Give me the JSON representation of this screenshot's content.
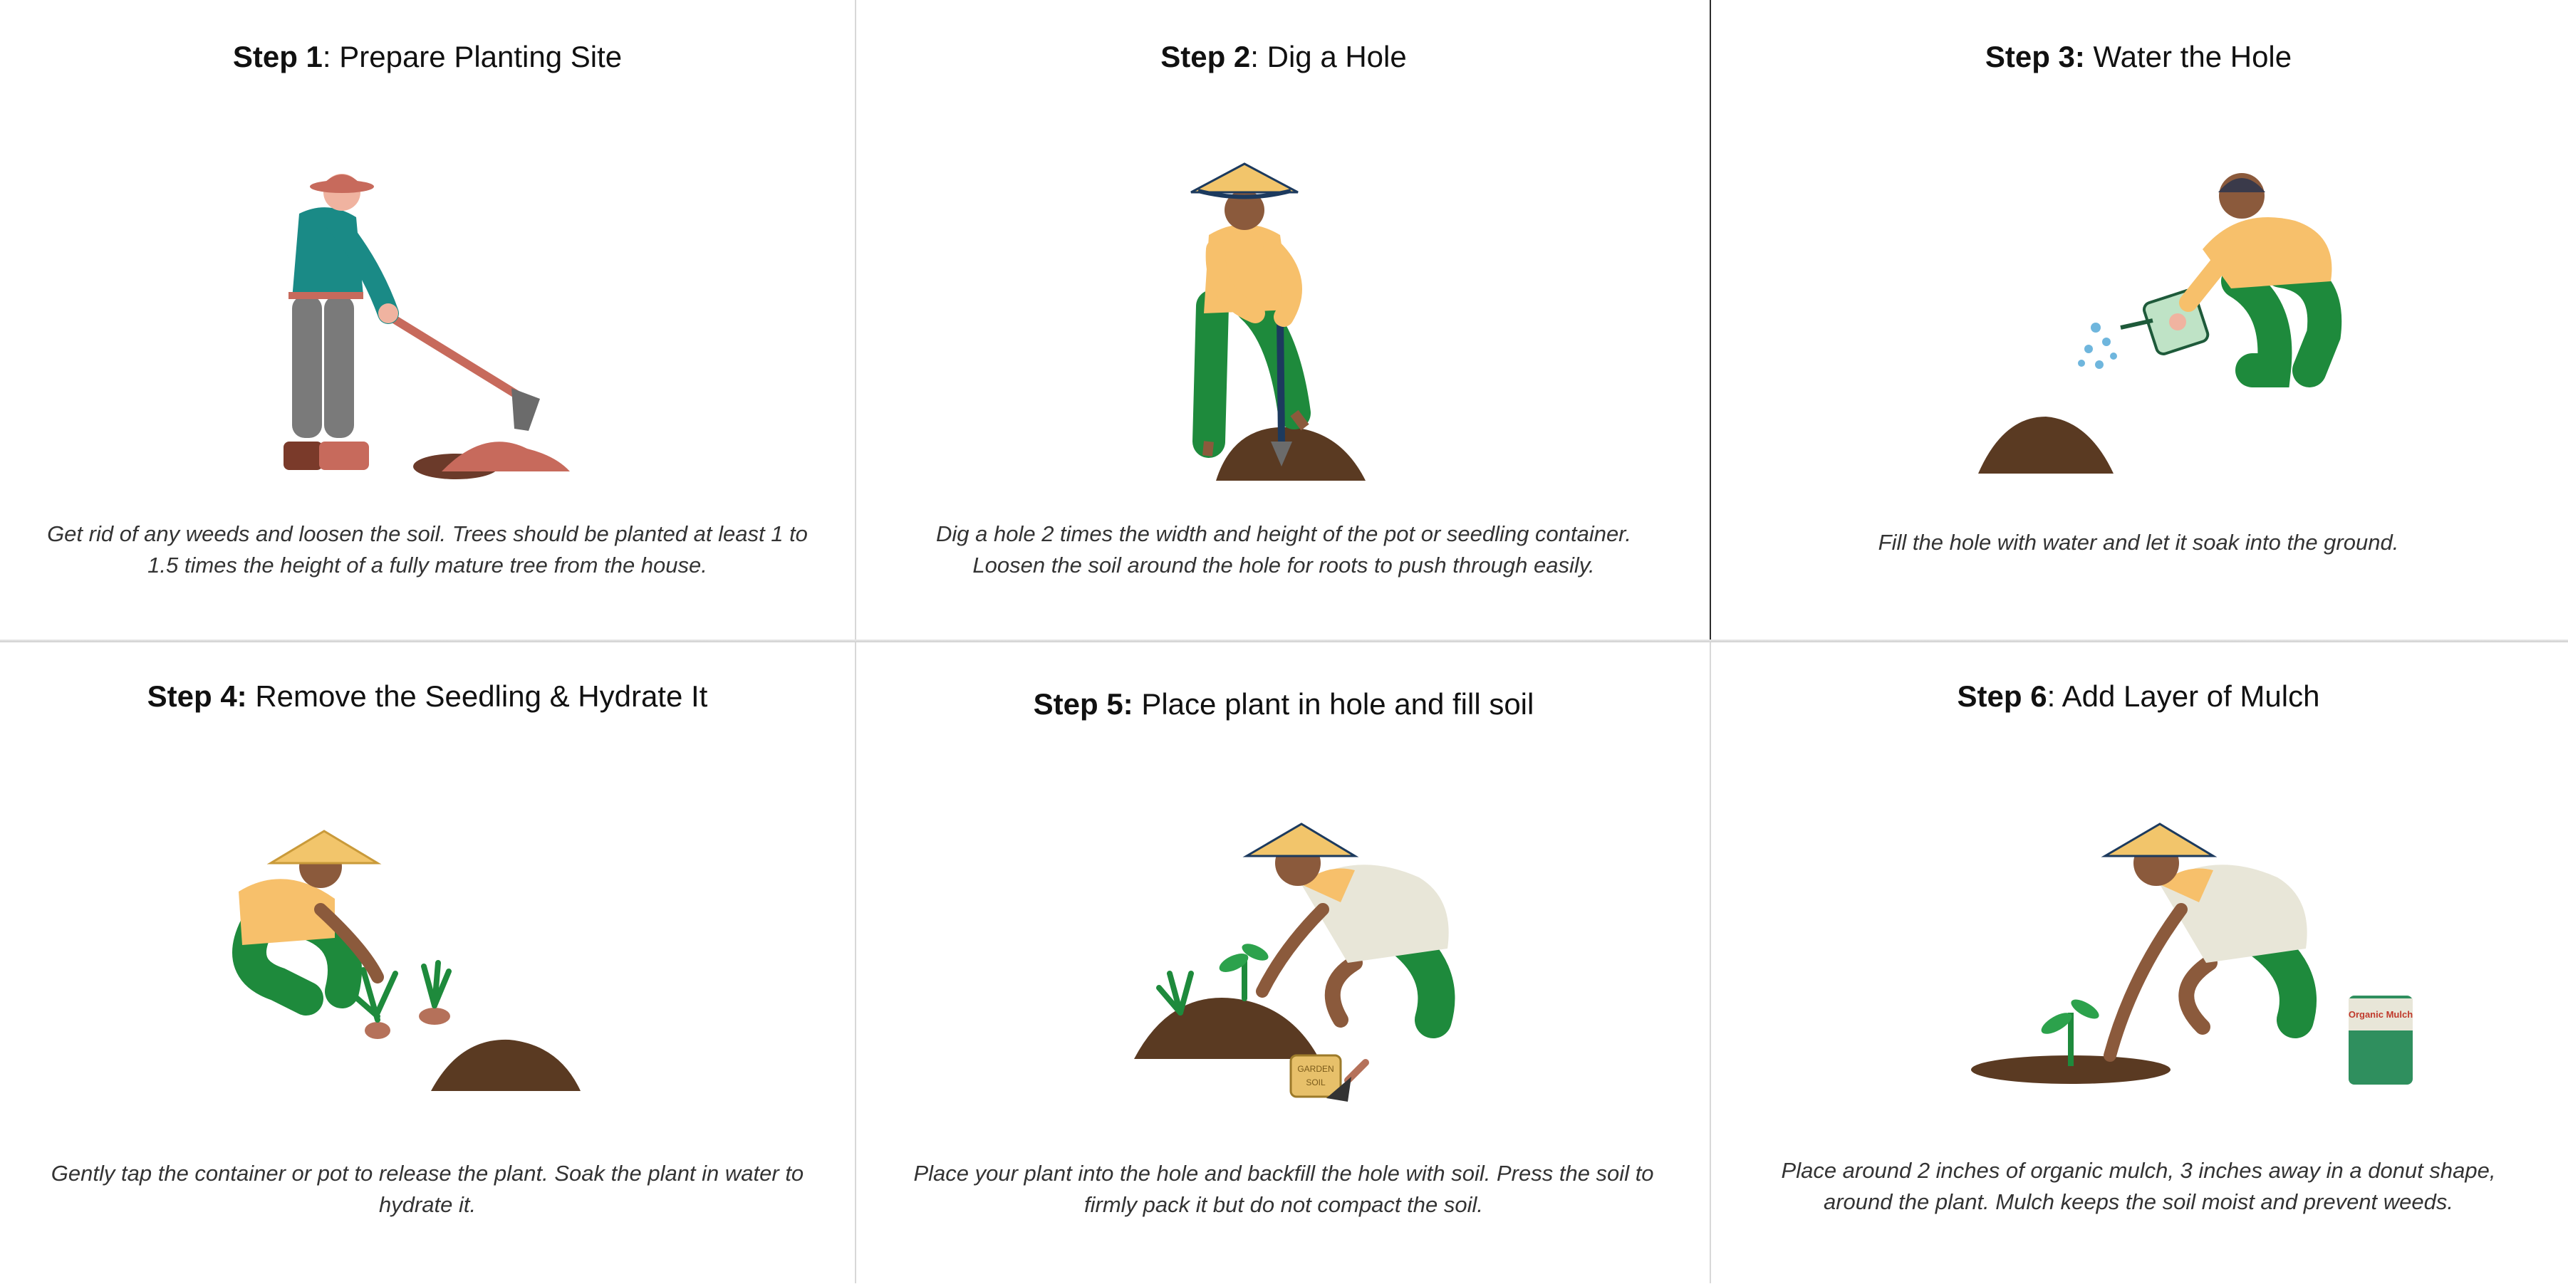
{
  "steps": [
    {
      "step_label": "Step 1",
      "title_sep": ":",
      "title": " Prepare Planting Site",
      "caption": "Get rid of any weeds and loosen the soil. Trees should be planted at least 1 to 1.5 times the height of a fully mature tree from the house.",
      "illustration": "farmer-hoeing-icon"
    },
    {
      "step_label": "Step 2",
      "title_sep": ":",
      "title": " Dig a Hole",
      "caption": "Dig a hole 2 times the width and height of the pot or seedling container. Loosen the soil around the hole for roots to push through easily.",
      "illustration": "farmer-digging-icon"
    },
    {
      "step_label": "Step 3:",
      "title_sep": "",
      "title": " Water the Hole",
      "caption": "Fill the hole with water and let it soak into the ground.",
      "illustration": "farmer-watering-icon"
    },
    {
      "step_label": "Step 4:",
      "title_sep": "",
      "title": " Remove the Seedling & Hydrate It",
      "caption": "Gently tap the container or pot to release the plant. Soak the plant in water to hydrate it.",
      "illustration": "farmer-seedlings-icon"
    },
    {
      "step_label": "Step 5:",
      "title_sep": "",
      "title": " Place plant in hole and fill soil",
      "caption": "Place your plant into the hole and backfill the hole with soil. Press the soil to firmly pack it but do not compact the soil.",
      "illustration": "farmer-planting-icon",
      "bag_label_1": "GARDEN",
      "bag_label_2": "SOIL"
    },
    {
      "step_label": "Step 6",
      "title_sep": ":",
      "title": " Add Layer of Mulch",
      "caption": "Place around 2 inches of organic mulch, 3 inches away in a donut shape, around the plant. Mulch keeps the soil moist and prevent weeds.",
      "illustration": "farmer-mulching-icon",
      "bag_label": "Organic Mulch"
    }
  ],
  "colors": {
    "soil": "#5a3a22",
    "skin": "#8b5a3c",
    "hat": "#f2c56b",
    "shirt_yellow": "#f7c06b",
    "pants_green": "#1e8a3c",
    "teal": "#1a8a86",
    "clay": "#c76a5c"
  }
}
